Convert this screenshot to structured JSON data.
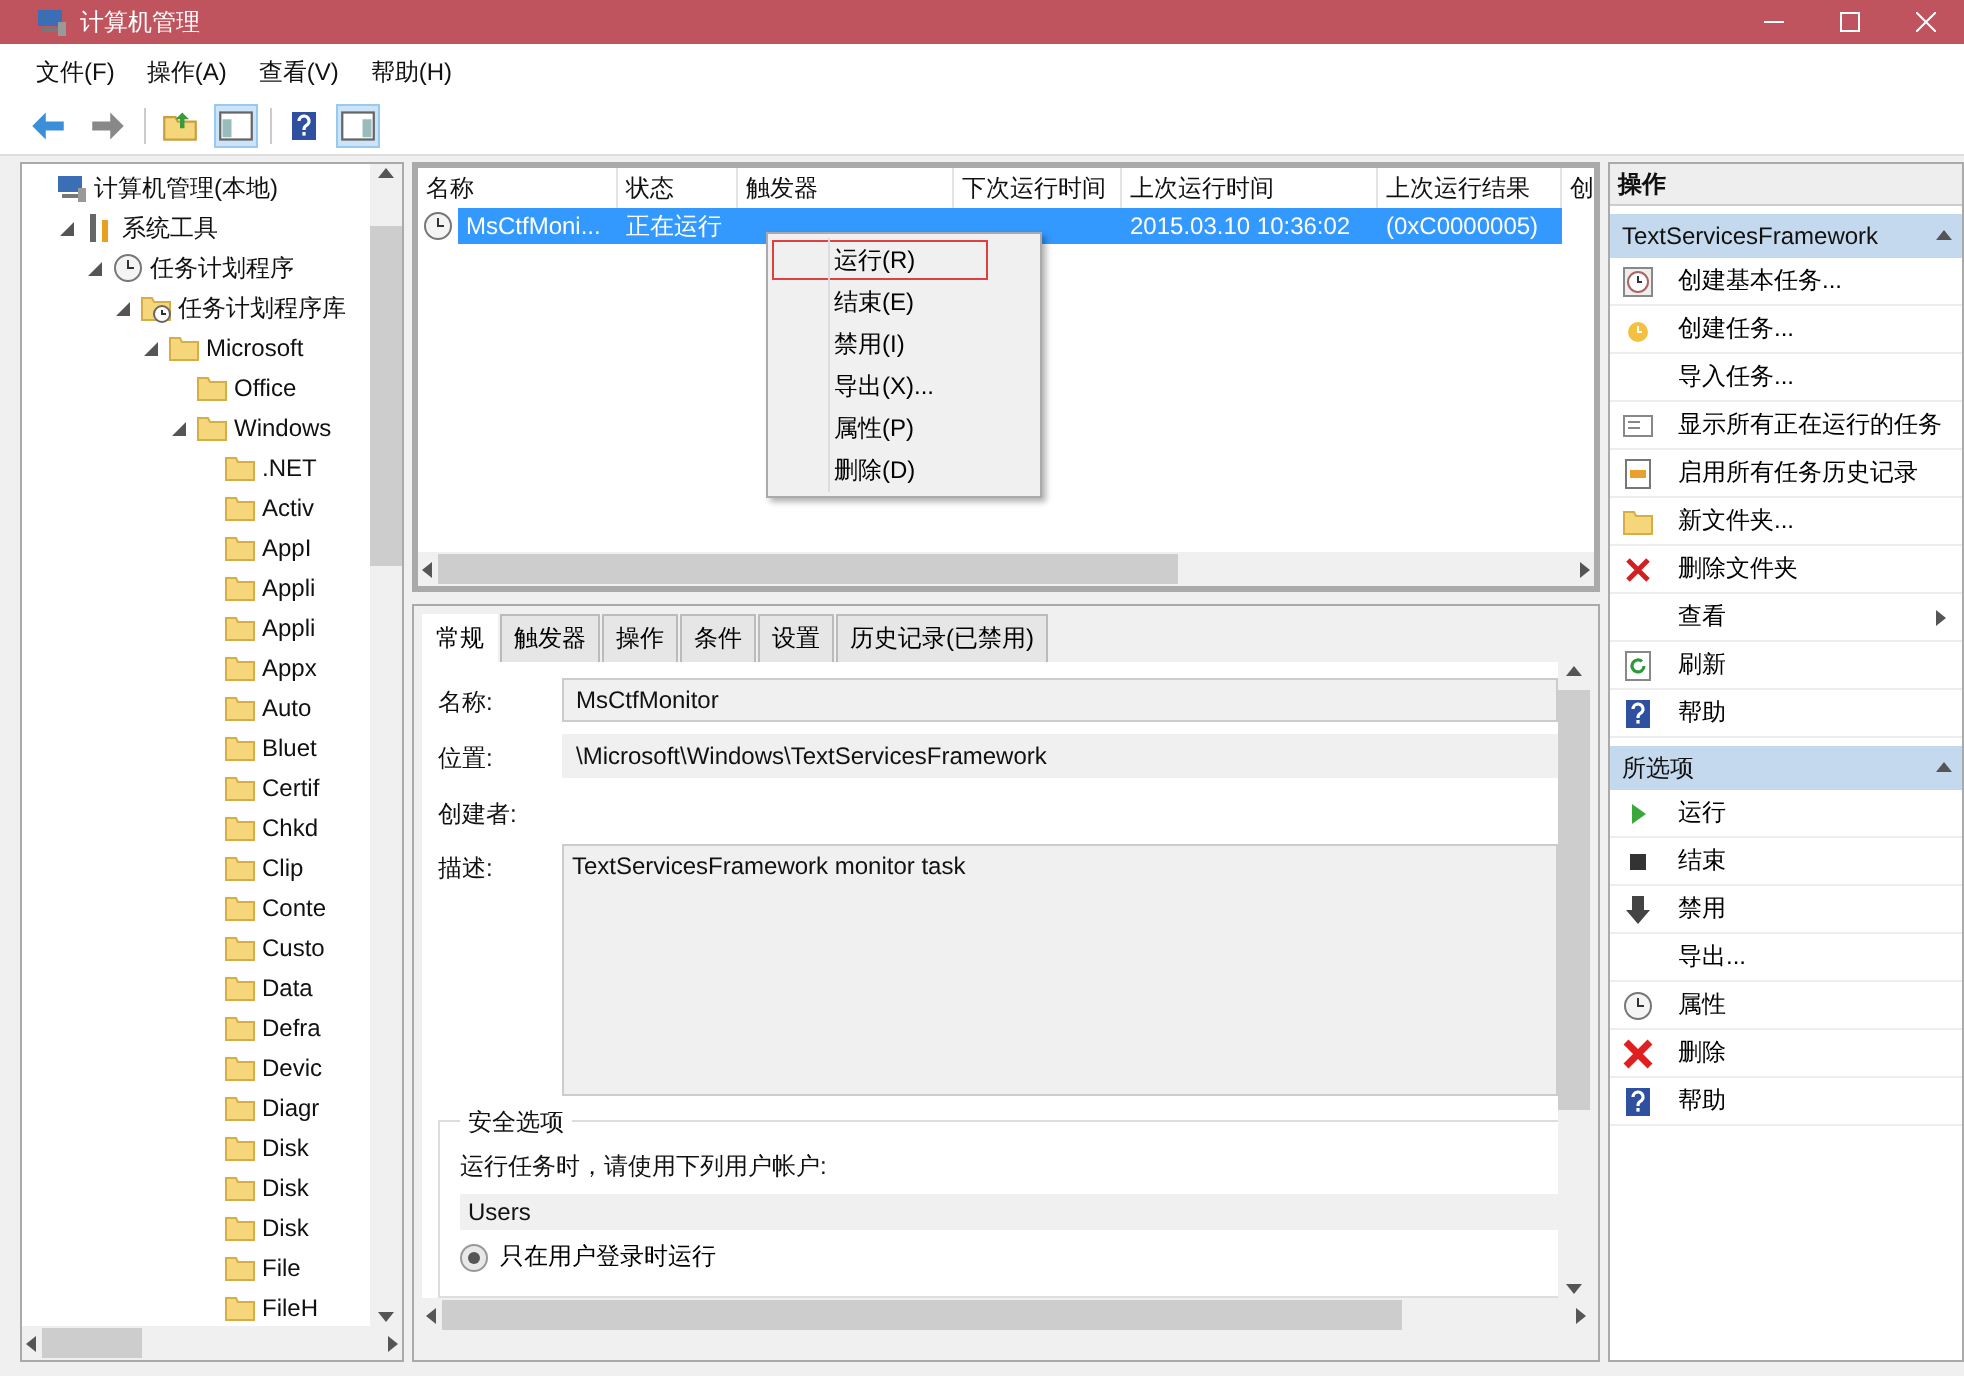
{
  "window": {
    "title": "计算机管理"
  },
  "menu": [
    "文件(F)",
    "操作(A)",
    "查看(V)",
    "帮助(H)"
  ],
  "toolbar": [
    {
      "kind": "back"
    },
    {
      "kind": "forward"
    },
    {
      "kind": "up"
    },
    {
      "kind": "pane",
      "selected": true
    },
    {
      "kind": "help"
    },
    {
      "kind": "pane2",
      "selected": true
    }
  ],
  "tree": [
    {
      "label": "计算机管理(本地)",
      "kind": "computer",
      "children": [
        {
          "label": "系统工具",
          "kind": "tools",
          "expanded": true,
          "children": [
            {
              "label": "任务计划程序",
              "kind": "clock",
              "expanded": true,
              "children": [
                {
                  "label": "任务计划程序库",
                  "kind": "library",
                  "expanded": true,
                  "children": [
                    {
                      "label": "Microsoft",
                      "kind": "folder",
                      "expanded": true,
                      "children": [
                        {
                          "label": "Office",
                          "kind": "folder"
                        },
                        {
                          "label": "Windows",
                          "kind": "folder",
                          "expanded": true,
                          "children": [
                            {
                              "label": ".NET",
                              "kind": "folder"
                            },
                            {
                              "label": "Activ",
                              "kind": "folder"
                            },
                            {
                              "label": "AppI",
                              "kind": "folder"
                            },
                            {
                              "label": "Appli",
                              "kind": "folder"
                            },
                            {
                              "label": "Appli",
                              "kind": "folder"
                            },
                            {
                              "label": "Appx",
                              "kind": "folder"
                            },
                            {
                              "label": "Auto",
                              "kind": "folder"
                            },
                            {
                              "label": "Bluet",
                              "kind": "folder"
                            },
                            {
                              "label": "Certif",
                              "kind": "folder"
                            },
                            {
                              "label": "Chkd",
                              "kind": "folder"
                            },
                            {
                              "label": "Clip",
                              "kind": "folder"
                            },
                            {
                              "label": "Conte",
                              "kind": "folder"
                            },
                            {
                              "label": "Custo",
                              "kind": "folder"
                            },
                            {
                              "label": "Data",
                              "kind": "folder"
                            },
                            {
                              "label": "Defra",
                              "kind": "folder"
                            },
                            {
                              "label": "Devic",
                              "kind": "folder"
                            },
                            {
                              "label": "Diagr",
                              "kind": "folder"
                            },
                            {
                              "label": "Disk",
                              "kind": "folder"
                            },
                            {
                              "label": "Disk",
                              "kind": "folder"
                            },
                            {
                              "label": "Disk",
                              "kind": "folder"
                            },
                            {
                              "label": "File",
                              "kind": "folder"
                            },
                            {
                              "label": "FileH",
                              "kind": "folder"
                            }
                          ]
                        }
                      ]
                    }
                  ]
                }
              ]
            }
          ]
        }
      ]
    }
  ],
  "task_list": {
    "columns": [
      "名称",
      "状态",
      "触发器",
      "下次运行时间",
      "上次运行时间",
      "上次运行结果",
      "创"
    ],
    "rows": [
      {
        "name": "MsCtfMoni...",
        "status": "正在运行",
        "last_run": "2015.03.10 10:36:02",
        "last_result": "(0xC0000005)",
        "selected": true
      }
    ]
  },
  "context_menu": [
    {
      "label": "运行(R)",
      "selected": true
    },
    {
      "label": "结束(E)",
      "selected": false
    },
    {
      "label": "禁用(I)",
      "selected": false
    },
    {
      "label": "导出(X)...",
      "selected": false
    },
    {
      "label": "属性(P)",
      "selected": false
    },
    {
      "label": "删除(D)",
      "selected": false
    }
  ],
  "tabs": [
    {
      "label": "常规",
      "selected": true
    },
    {
      "label": "触发器",
      "selected": false
    },
    {
      "label": "操作",
      "selected": false
    },
    {
      "label": "条件",
      "selected": false
    },
    {
      "label": "设置",
      "selected": false
    },
    {
      "label": "历史记录(已禁用)",
      "selected": false
    }
  ],
  "general": {
    "name_label": "名称:",
    "name_value": "MsCtfMonitor",
    "location_label": "位置:",
    "location_value": "\\Microsoft\\Windows\\TextServicesFramework",
    "author_label": "创建者:",
    "description_label": "描述:",
    "description_value": "TextServicesFramework monitor task",
    "security": {
      "legend": "安全选项",
      "prompt": "运行任务时，请使用下列用户帐户:",
      "account": "Users",
      "options": [
        {
          "label": "只在用户登录时运行",
          "selected": true
        }
      ]
    }
  },
  "actions": {
    "title": "操作",
    "sections": [
      {
        "title": "TextServicesFramework",
        "items": [
          {
            "label": "创建基本任务...",
            "kind": "wizard"
          },
          {
            "label": "创建任务...",
            "kind": "task"
          },
          {
            "label": "导入任务...",
            "kind": "plain"
          },
          {
            "label": "显示所有正在运行的任务",
            "kind": "list"
          },
          {
            "label": "启用所有任务历史记录",
            "kind": "log"
          },
          {
            "label": "新文件夹...",
            "kind": "folder"
          },
          {
            "label": "删除文件夹",
            "kind": "delete"
          },
          {
            "label": "查看",
            "kind": "submenu"
          },
          {
            "label": "刷新",
            "kind": "refresh"
          },
          {
            "label": "帮助",
            "kind": "help"
          }
        ]
      },
      {
        "title": "所选项",
        "items": [
          {
            "label": "运行",
            "kind": "play"
          },
          {
            "label": "结束",
            "kind": "stop"
          },
          {
            "label": "禁用",
            "kind": "down"
          },
          {
            "label": "导出...",
            "kind": "plain"
          },
          {
            "label": "属性",
            "kind": "clock"
          },
          {
            "label": "删除",
            "kind": "bigdelete"
          },
          {
            "label": "帮助",
            "kind": "help"
          }
        ]
      }
    ]
  }
}
